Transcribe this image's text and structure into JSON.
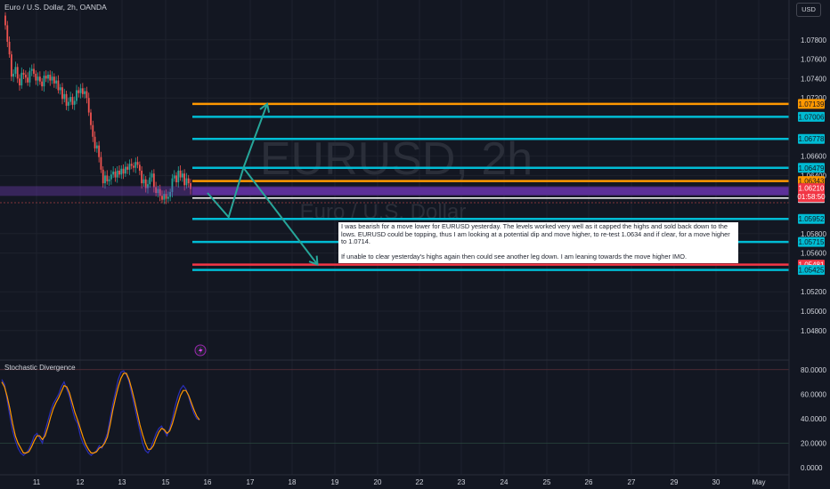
{
  "header": {
    "title": "Euro / U.S. Dollar, 2h, OANDA",
    "currency_button": "USD"
  },
  "watermark": {
    "symbol": "EURUSD, 2h",
    "name": "Euro / U.S. Dollar"
  },
  "annotation": {
    "paragraph1": "I was bearish for a move lower for EURUSD yesterday. The levels worked very well as it capped the highs and sold back down to the lows. EURUSD could be topping, thus I am looking at a potential dip and move higher, to re-test 1.0634 and if clear, for a move higher to 1.0714.",
    "paragraph2": "If unable to clear yesterday's highs again then could see another leg down. I am leaning towards the move higher IMO."
  },
  "oscillator": {
    "title": "Stochastic Divergence"
  },
  "colors": {
    "background": "#131722",
    "up": "#26a69a",
    "down": "#ef5350",
    "cyan": "#00bcd4",
    "orange": "#ff9800",
    "red": "#f23645",
    "purple": "#7b3fc4",
    "grid": "#1e222d",
    "stoch_k": "#2a2eb8",
    "stoch_d": "#ff9800"
  },
  "chart_data": {
    "type": "candlestick",
    "title": "Euro / U.S. Dollar, 2h, OANDA",
    "ylim": [
      1.0465,
      1.0815
    ],
    "y_ticks": [
      "1.07800",
      "1.07600",
      "1.07400",
      "1.07200",
      "1.06600",
      "1.06400",
      "1.05800",
      "1.05600",
      "1.05200",
      "1.05000",
      "1.04800"
    ],
    "x_ticks": [
      "11",
      "12",
      "13",
      "15",
      "16",
      "17",
      "18",
      "19",
      "20",
      "22",
      "23",
      "24",
      "25",
      "26",
      "27",
      "29",
      "30",
      "May",
      "2",
      "3",
      "4",
      "6"
    ],
    "last_close": 1.0621,
    "candles_close": [
      1.0795,
      1.0778,
      1.0765,
      1.0742,
      1.0745,
      1.0752,
      1.074,
      1.0733,
      1.0746,
      1.0744,
      1.0741,
      1.0736,
      1.0748,
      1.075,
      1.0745,
      1.0738,
      1.0742,
      1.0737,
      1.0732,
      1.0743,
      1.074,
      1.0744,
      1.0738,
      1.0742,
      1.0735,
      1.0738,
      1.0728,
      1.0731,
      1.0719,
      1.0724,
      1.0712,
      1.0716,
      1.0721,
      1.0713,
      1.0717,
      1.0728,
      1.0725,
      1.073,
      1.0724,
      1.0727,
      1.072,
      1.0705,
      1.0692,
      1.068,
      1.0668,
      1.0671,
      1.0659,
      1.0646,
      1.0632,
      1.064,
      1.0634,
      1.0636,
      1.0641,
      1.0644,
      1.0638,
      1.0645,
      1.0641,
      1.0647,
      1.0642,
      1.0649,
      1.0646,
      1.0652,
      1.065,
      1.0648,
      1.0654,
      1.0651,
      1.0645,
      1.0632,
      1.0636,
      1.0627,
      1.0631,
      1.0638,
      1.0642,
      1.0628,
      1.0622,
      1.0626,
      1.0619,
      1.0615,
      1.0621,
      1.0616,
      1.0618,
      1.0623,
      1.0637,
      1.064,
      1.0633,
      1.0645,
      1.0638,
      1.0642,
      1.063,
      1.0637,
      1.0632,
      1.0626
    ],
    "horizontal_levels": [
      {
        "value": 1.07139,
        "label": "1.07139",
        "color": "orange"
      },
      {
        "value": 1.07006,
        "label": "1.07006",
        "color": "cyan"
      },
      {
        "value": 1.06778,
        "label": "1.06778",
        "color": "cyan"
      },
      {
        "value": 1.06479,
        "label": "1.06479",
        "color": "cyan"
      },
      {
        "value": 1.06343,
        "label": "1.06343",
        "color": "orange"
      },
      {
        "value": 1.06168,
        "label": "1.06168",
        "color": "white"
      },
      {
        "value": 1.05952,
        "label": "1.05952",
        "color": "cyan"
      },
      {
        "value": 1.05715,
        "label": "1.05715",
        "color": "cyan"
      },
      {
        "value": 1.05481,
        "label": "1.05481",
        "color": "red"
      },
      {
        "value": 1.05425,
        "label": "1.05425",
        "color": "cyan"
      }
    ],
    "purple_zone": [
      1.0619,
      1.0629
    ],
    "price_tag": {
      "price": "1.06210",
      "time": "01:58:50"
    },
    "scenario_paths": [
      {
        "direction": "up",
        "points": [
          [
            1.0622,
            "17"
          ],
          [
            1.0597,
            "17.5"
          ],
          [
            1.0648,
            "17.85"
          ],
          [
            1.07139,
            "18.4"
          ]
        ]
      },
      {
        "direction": "down",
        "points": [
          [
            1.0648,
            "17.85"
          ],
          [
            1.05481,
            "19.6"
          ]
        ]
      }
    ],
    "oscillator": {
      "name": "Stochastic Divergence",
      "ylim": [
        0,
        80
      ],
      "y_ticks": [
        "80.0000",
        "60.0000",
        "40.0000",
        "20.0000",
        "0.0000"
      ],
      "k": [
        72,
        68,
        55,
        42,
        30,
        22,
        16,
        12,
        10,
        12,
        15,
        20,
        26,
        28,
        24,
        20,
        30,
        38,
        46,
        52,
        56,
        60,
        66,
        70,
        64,
        58,
        48,
        40,
        36,
        26,
        20,
        16,
        12,
        10,
        12,
        14,
        18,
        16,
        22,
        28,
        40,
        52,
        62,
        72,
        78,
        79,
        76,
        70,
        60,
        50,
        40,
        30,
        20,
        14,
        12,
        16,
        22,
        28,
        32,
        34,
        30,
        26,
        32,
        40,
        50,
        58,
        64,
        67,
        64,
        58,
        50,
        44,
        40,
        39
      ],
      "d": [
        70,
        66,
        58,
        48,
        36,
        26,
        20,
        16,
        12,
        12,
        13,
        17,
        22,
        26,
        26,
        23,
        26,
        33,
        41,
        48,
        53,
        57,
        62,
        67,
        66,
        61,
        53,
        45,
        39,
        32,
        25,
        19,
        15,
        12,
        12,
        13,
        16,
        17,
        20,
        25,
        35,
        47,
        57,
        66,
        73,
        77,
        77,
        72,
        64,
        55,
        45,
        35,
        27,
        20,
        15,
        15,
        18,
        24,
        29,
        32,
        31,
        28,
        30,
        36,
        44,
        52,
        59,
        63,
        63,
        59,
        53,
        47,
        42,
        39
      ]
    }
  }
}
